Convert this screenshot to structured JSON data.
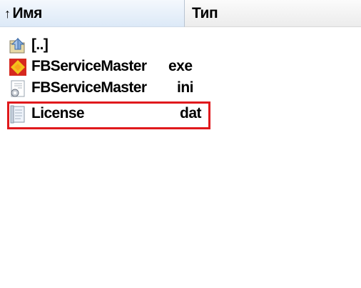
{
  "header": {
    "name_label": "Имя",
    "type_label": "Тип",
    "sort_arrow": "↑"
  },
  "files": [
    {
      "name": "[..]",
      "ext": "",
      "icon": "up-folder-icon"
    },
    {
      "name": "FBServiceMaster",
      "ext": "exe",
      "icon": "app-exe-icon"
    },
    {
      "name": "FBServiceMaster",
      "ext": "ini",
      "icon": "ini-config-icon"
    },
    {
      "name": "License",
      "ext": "dat",
      "icon": "document-icon",
      "highlighted": true
    }
  ],
  "colors": {
    "highlight_border": "#e0191c",
    "header_name_bg": "#dce9f7",
    "header_type_bg": "#ececec"
  }
}
